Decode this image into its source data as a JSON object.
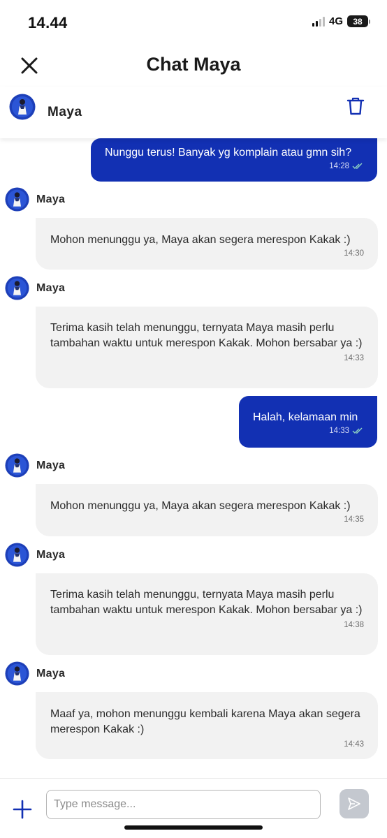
{
  "status_bar": {
    "time": "14.44",
    "network": "4G",
    "battery": "38"
  },
  "header": {
    "title": "Chat Maya"
  },
  "contact": {
    "name": "Maya"
  },
  "messages": [
    {
      "from": "user",
      "text": "Nunggu terus! Banyak yg komplain atau gmn sih?",
      "time": "14:28"
    },
    {
      "from": "bot",
      "sender": "Maya",
      "text": "Mohon menunggu ya, Maya akan segera merespon Kakak :)",
      "time": "14:30"
    },
    {
      "from": "bot",
      "sender": "Maya",
      "text": "Terima kasih telah menunggu, ternyata Maya masih perlu tambahan waktu untuk merespon Kakak. Mohon bersabar ya :)",
      "time": "14:33"
    },
    {
      "from": "user",
      "text": "Halah, kelamaan min",
      "time": "14:33"
    },
    {
      "from": "bot",
      "sender": "Maya",
      "text": "Mohon menunggu ya, Maya akan segera merespon Kakak :)",
      "time": "14:35"
    },
    {
      "from": "bot",
      "sender": "Maya",
      "text": "Terima kasih telah menunggu, ternyata Maya masih perlu tambahan waktu untuk merespon Kakak. Mohon bersabar ya :)",
      "time": "14:38"
    },
    {
      "from": "bot",
      "sender": "Maya",
      "text": "Maaf ya, mohon menunggu kembali karena Maya akan segera merespon Kakak :)",
      "time": "14:43"
    }
  ],
  "input": {
    "placeholder": "Type message..."
  },
  "colors": {
    "brand_blue": "#1230b3",
    "bubble_gray": "#f2f2f2",
    "send_disabled": "#c4c8cf"
  },
  "icons": {
    "close": "close-icon",
    "trash": "trash-icon",
    "attach": "plus-icon",
    "send": "send-icon"
  }
}
